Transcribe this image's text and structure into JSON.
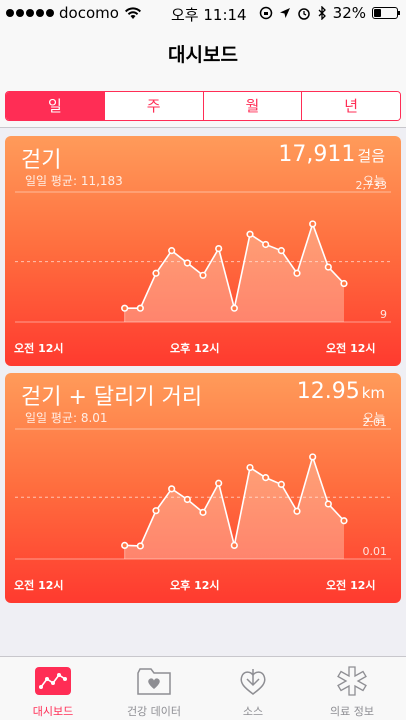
{
  "status_bar": {
    "carrier": "docomo",
    "time": "오후 11:14",
    "battery_text": "32%",
    "battery_level": 0.32
  },
  "nav": {
    "title": "대시보드"
  },
  "segments": [
    "일",
    "주",
    "월",
    "년"
  ],
  "cards": [
    {
      "title": "걷기",
      "value": "17,911",
      "unit": "걸음",
      "avg_label": "일일 평균: 11,183",
      "today_label": "오늘",
      "y_max_label": "2,733",
      "y_min_label": "9",
      "x_labels": [
        "오전 12시",
        "오후 12시",
        "오전 12시"
      ]
    },
    {
      "title": "걷기 + 달리기 거리",
      "value": "12.95",
      "unit": "km",
      "avg_label": "일일 평균: 8.01",
      "today_label": "오늘",
      "y_max_label": "2.01",
      "y_min_label": "0.01",
      "x_labels": [
        "오전 12시",
        "오후 12시",
        "오전 12시"
      ]
    }
  ],
  "chart_data": [
    {
      "type": "line",
      "title": "걷기",
      "x": [
        7,
        8,
        9,
        10,
        11,
        12,
        13,
        14,
        15,
        16,
        17,
        18,
        19,
        20,
        21
      ],
      "values": [
        150,
        150,
        1000,
        1550,
        1250,
        950,
        1600,
        150,
        1950,
        1700,
        1550,
        1000,
        2200,
        1150,
        750
      ],
      "ylim": [
        9,
        2733
      ],
      "y_tick_labels": [
        "9",
        "2,733"
      ],
      "x_tick_labels": [
        "오전 12시",
        "오후 12시",
        "오전 12시"
      ],
      "avg": 1283
    },
    {
      "type": "line",
      "title": "걷기 + 달리기 거리",
      "x": [
        7,
        8,
        9,
        10,
        11,
        12,
        13,
        14,
        15,
        16,
        17,
        18,
        19,
        20,
        21
      ],
      "values": [
        0.11,
        0.1,
        0.73,
        1.12,
        0.93,
        0.7,
        1.22,
        0.11,
        1.5,
        1.32,
        1.2,
        0.72,
        1.69,
        0.85,
        0.55
      ],
      "ylim": [
        0.01,
        2.01
      ],
      "y_tick_labels": [
        "0.01",
        "2.01"
      ],
      "x_tick_labels": [
        "오전 12시",
        "오후 12시",
        "오전 12시"
      ],
      "avg": 0.97
    }
  ],
  "tabs": [
    {
      "label": "대시보드",
      "icon": "dashboard-icon",
      "active": true
    },
    {
      "label": "건강 데이터",
      "icon": "health-data-icon",
      "active": false
    },
    {
      "label": "소스",
      "icon": "sources-icon",
      "active": false
    },
    {
      "label": "의료 정보",
      "icon": "medical-id-icon",
      "active": false
    }
  ]
}
